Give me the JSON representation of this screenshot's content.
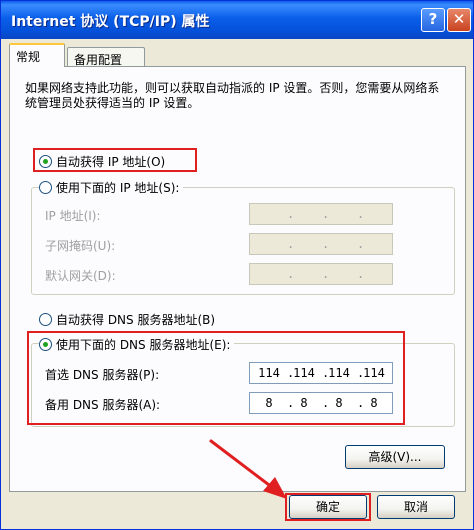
{
  "window": {
    "title": "Internet 协议 (TCP/IP) 属性"
  },
  "titlebar": {
    "help_glyph": "?",
    "close_glyph": "✕"
  },
  "tabs": [
    {
      "label": "常规",
      "active": true
    },
    {
      "label": "备用配置",
      "active": false
    }
  ],
  "description": "如果网络支持此功能，则可以获取自动指派的 IP 设置。否则，您需要从网络系统管理员处获得适当的 IP 设置。",
  "ip_section": {
    "auto_label": "自动获得 IP 地址(O)",
    "manual_label": "使用下面的 IP 地址(S):",
    "selected": "auto",
    "fields": [
      {
        "label": "IP 地址(I):"
      },
      {
        "label": "子网掩码(U):"
      },
      {
        "label": "默认网关(D):"
      }
    ]
  },
  "dns_section": {
    "auto_label": "自动获得 DNS 服务器地址(B)",
    "manual_label": "使用下面的 DNS 服务器地址(E):",
    "selected": "manual",
    "preferred": {
      "label": "首选 DNS 服务器(P):",
      "octets": [
        "114",
        "114",
        "114",
        "114"
      ]
    },
    "alternate": {
      "label": "备用 DNS 服务器(A):",
      "octets": [
        "8",
        "8",
        "8",
        "8"
      ]
    }
  },
  "buttons": {
    "advanced": "高级(V)...",
    "ok": "确定",
    "cancel": "取消"
  },
  "colors": {
    "highlight": "#e02020",
    "radio_dot": "#21a121",
    "titlebar": "#0550d8"
  }
}
